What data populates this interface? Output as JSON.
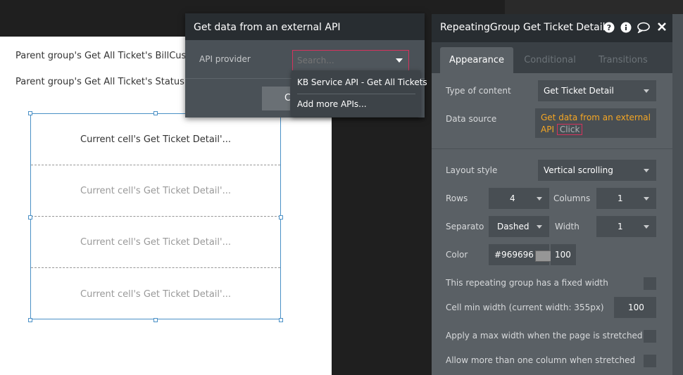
{
  "canvas": {
    "text1": "Parent group's Get All Ticket's BillCusto",
    "text2": "Parent group's Get All Ticket's Status",
    "cells": [
      "Current cell's Get Ticket Detail'...",
      "Current cell's Get Ticket Detail'...",
      "Current cell's Get Ticket Detail'...",
      "Current cell's Get Ticket Detail'..."
    ]
  },
  "api_popup": {
    "title": "Get data from an external API",
    "provider_label": "API provider",
    "search_placeholder": "Search...",
    "button_label": "C",
    "options": [
      "KB Service API - Get All Tickets",
      "Add more APIs..."
    ]
  },
  "panel": {
    "title": "RepeatingGroup Get Ticket Detail",
    "header_icons": [
      "help-icon",
      "info-icon",
      "comment-icon",
      "close-icon"
    ],
    "tabs": [
      "Appearance",
      "Conditional",
      "Transitions"
    ],
    "active_tab": "Appearance",
    "type_of_content_label": "Type of content",
    "type_of_content_value": "Get Ticket Detail",
    "data_source_label": "Data source",
    "data_source_value": "Get data from an external API",
    "data_source_click": "Click",
    "layout_style_label": "Layout style",
    "layout_style_value": "Vertical scrolling",
    "rows_label": "Rows",
    "rows_value": "4",
    "columns_label": "Columns",
    "columns_value": "1",
    "separator_label": "Separato",
    "separator_value": "Dashed",
    "width_label": "Width",
    "width_value": "1",
    "color_label": "Color",
    "color_hex": "#969696",
    "color_opacity": "100",
    "fixed_width_label": "This repeating group has a fixed width",
    "cell_min_width_label": "Cell min width (current width: 355px)",
    "cell_min_width_value": "100",
    "max_width_label": "Apply a max width when the page is stretched",
    "more_columns_label": "Allow more than one column when stretched"
  },
  "colors": {
    "accent_red": "#d6335d",
    "datasource_orange": "#f5a623",
    "selection_blue": "#4a90c6"
  }
}
